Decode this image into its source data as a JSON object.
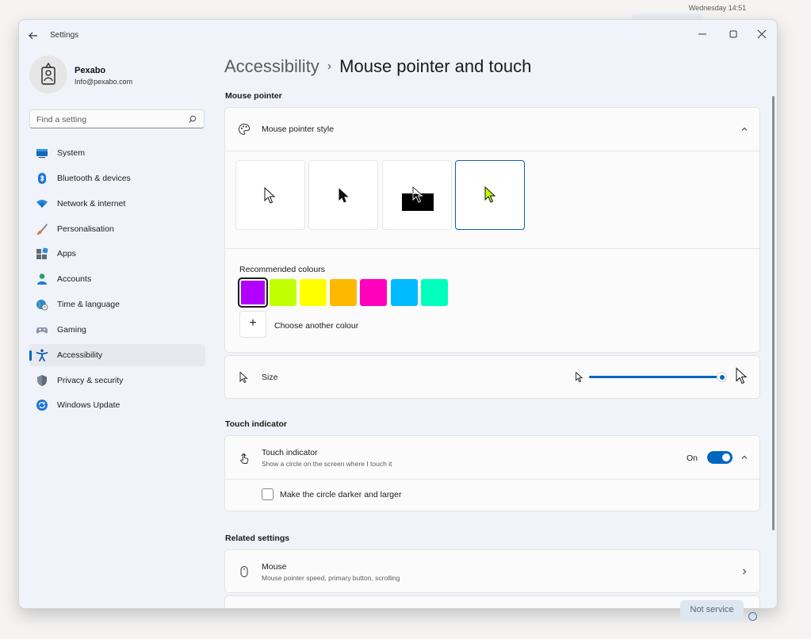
{
  "desktop": {
    "clock": "Wednesday 14:51",
    "notification_text": "Not service"
  },
  "window": {
    "title": "Settings",
    "controls": [
      "minimize-icon",
      "maximize-icon",
      "close-icon"
    ]
  },
  "profile": {
    "name": "Pexabo",
    "email": "Info@pexabo.com"
  },
  "search": {
    "placeholder": "Find a setting"
  },
  "sidebar": {
    "items": [
      {
        "label": "System",
        "icon": "monitor-icon",
        "active": false
      },
      {
        "label": "Bluetooth & devices",
        "icon": "bluetooth-icon",
        "active": false
      },
      {
        "label": "Network & internet",
        "icon": "wifi-icon",
        "active": false
      },
      {
        "label": "Personalisation",
        "icon": "brush-icon",
        "active": false
      },
      {
        "label": "Apps",
        "icon": "apps-icon",
        "active": false
      },
      {
        "label": "Accounts",
        "icon": "person-icon",
        "active": false
      },
      {
        "label": "Time & language",
        "icon": "globe-clock-icon",
        "active": false
      },
      {
        "label": "Gaming",
        "icon": "gamepad-icon",
        "active": false
      },
      {
        "label": "Accessibility",
        "icon": "accessibility-icon",
        "active": true
      },
      {
        "label": "Privacy & security",
        "icon": "shield-icon",
        "active": false
      },
      {
        "label": "Windows Update",
        "icon": "update-icon",
        "active": false
      }
    ]
  },
  "breadcrumb": {
    "parent": "Accessibility",
    "separator": "›",
    "current": "Mouse pointer and touch"
  },
  "mouse_pointer": {
    "section_title": "Mouse pointer",
    "style_label": "Mouse pointer style",
    "style_options": [
      "white-pointer",
      "black-pointer",
      "inverted-pointer",
      "custom-color-pointer"
    ],
    "selected_style": "custom-color-pointer",
    "recommended_colours_label": "Recommended colours",
    "colours": [
      "#b200ff",
      "#bfff00",
      "#ffff00",
      "#ffb800",
      "#ff00bd",
      "#00baff",
      "#00ffbd"
    ],
    "selected_colour": "#b200ff",
    "choose_colour_label": "Choose another colour",
    "plus": "+",
    "size_label": "Size",
    "size_value_fraction": 1.0
  },
  "touch_indicator": {
    "section_title": "Touch indicator",
    "label": "Touch indicator",
    "description": "Show a circle on the screen where I touch it",
    "state_label": "On",
    "enabled": true,
    "darker_option": "Make the circle darker and larger",
    "darker_checked": false
  },
  "related": {
    "section_title": "Related settings",
    "mouse_label": "Mouse",
    "mouse_description": "Mouse pointer speed, primary button, scrolling"
  },
  "colors": {
    "accent": "#0067c0",
    "pointer_custom": "#bfff00"
  }
}
